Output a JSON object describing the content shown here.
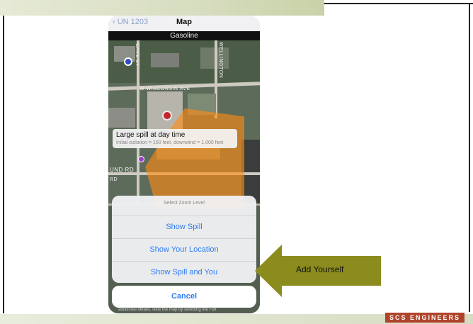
{
  "navbar": {
    "back_label": "UN 1203",
    "title": "Map"
  },
  "material": "Gasoline",
  "map": {
    "road_labels": [
      "W WISCONSIN AVE",
      "CAVE ST",
      "WELLINGTON",
      "UND RD",
      "RD"
    ]
  },
  "callout": {
    "title": "Large spill at day time",
    "detail": "Initial isolation = 150 feet, downwind = 1,000 feet"
  },
  "action_sheet": {
    "title": "Select Zoom Level",
    "options": [
      "Show Spill",
      "Show Your Location",
      "Show Spill and You"
    ],
    "cancel": "Cancel"
  },
  "footer_text": "additional details, view the map by selecting the Full",
  "annotation": {
    "label": "Add Yourself"
  },
  "brand": "SCS ENGINEERS",
  "colors": {
    "accent": "#2d7cf6",
    "spill": "#ff8c14",
    "arrow": "#8c8c1e",
    "brand": "#b0432c"
  }
}
